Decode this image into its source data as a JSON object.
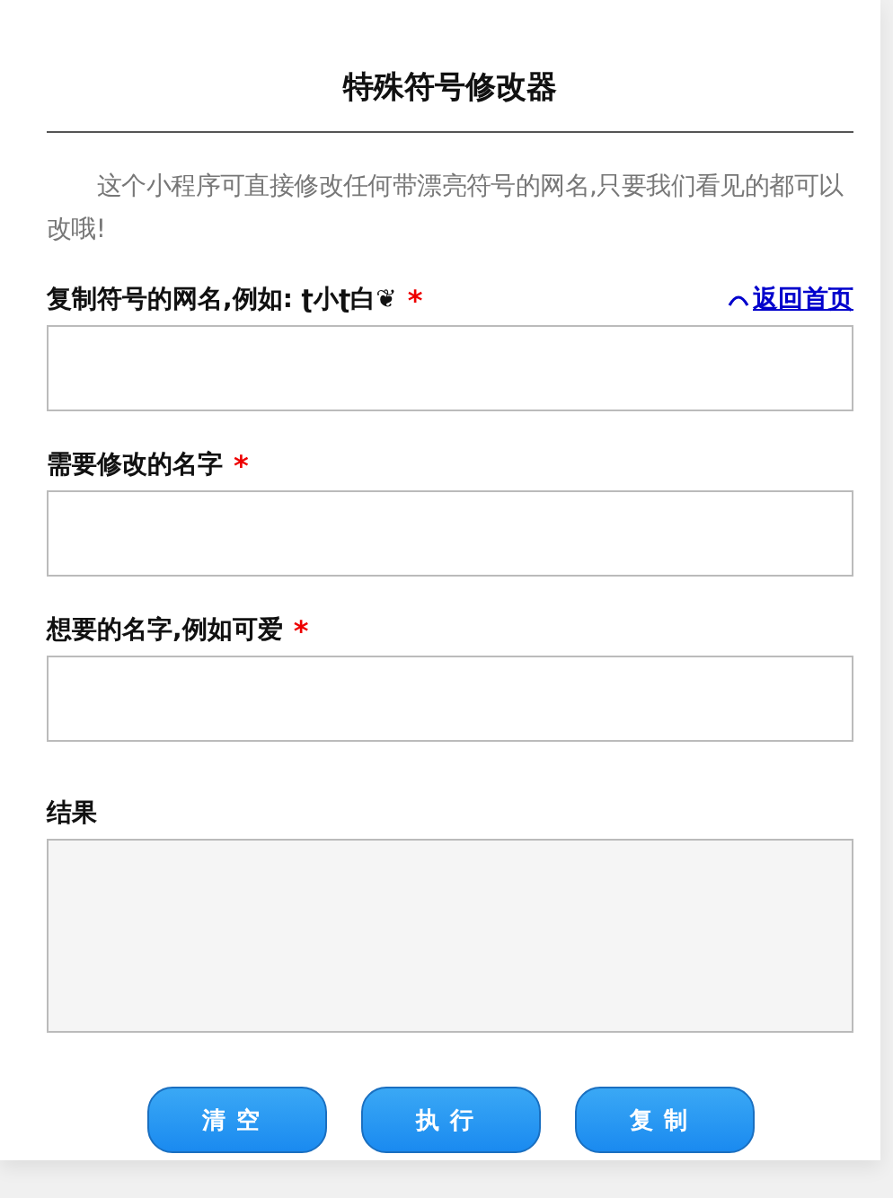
{
  "title": "特殊符号修改器",
  "intro": "这个小程序可直接修改任何带漂亮符号的网名,只要我们看见的都可以改哦!",
  "back_link": {
    "text": "返回首页"
  },
  "fields": [
    {
      "label": "复制符号的网名,例如: ʈ小ʈ白❦",
      "required_mark": "*"
    },
    {
      "label": "需要修改的名字",
      "required_mark": "*"
    },
    {
      "label": "想要的名字,例如可爱",
      "required_mark": "*"
    }
  ],
  "result": {
    "label": "结果"
  },
  "buttons": [
    "清空",
    "执行",
    "复制"
  ]
}
